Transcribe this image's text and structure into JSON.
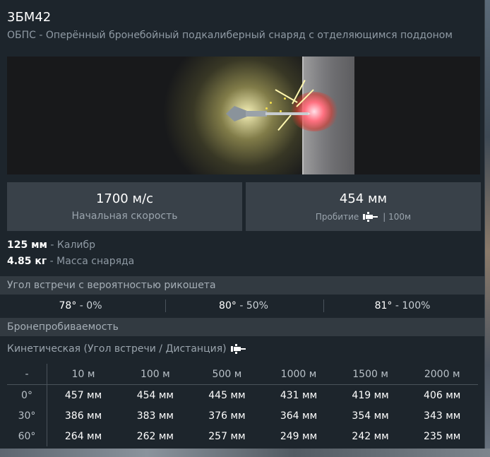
{
  "header": {
    "title": "3БМ42",
    "subtitle": "ОБПС - Оперённый бронебойный подкалиберный снаряд с отделяющимся поддоном"
  },
  "stats": {
    "velocity_value": "1700 м/с",
    "velocity_label": "Начальная скорость",
    "penetration_value": "454 мм",
    "penetration_label": "Пробитие",
    "penetration_range": "| 100м"
  },
  "specs": {
    "caliber_value": "125 мм",
    "caliber_label": " - Калибр",
    "mass_value": "4.85 кг",
    "mass_label": " - Масса снаряда"
  },
  "ricochet": {
    "title": "Угол встречи с вероятностью рикошета",
    "cells": [
      {
        "angle": "78°",
        "chance": " - 0%"
      },
      {
        "angle": "80°",
        "chance": " - 50%"
      },
      {
        "angle": "81°",
        "chance": " - 100%"
      }
    ]
  },
  "armor": {
    "title": "Бронепробиваемость",
    "kinetic_label": "Кинетическая (Угол встречи / Дистанция)",
    "corner": "-",
    "distances": [
      "10 м",
      "100 м",
      "500 м",
      "1000 м",
      "1500 м",
      "2000 м"
    ],
    "rows": [
      {
        "angle": "0°",
        "values": [
          "457 мм",
          "454 мм",
          "445 мм",
          "431 мм",
          "419 мм",
          "406 мм"
        ]
      },
      {
        "angle": "30°",
        "values": [
          "386 мм",
          "383 мм",
          "376 мм",
          "364 мм",
          "354 мм",
          "343 мм"
        ]
      },
      {
        "angle": "60°",
        "values": [
          "264 мм",
          "262 мм",
          "257 мм",
          "249 мм",
          "242 мм",
          "235 мм"
        ]
      }
    ]
  },
  "icons": {
    "shell": "shell-icon"
  }
}
